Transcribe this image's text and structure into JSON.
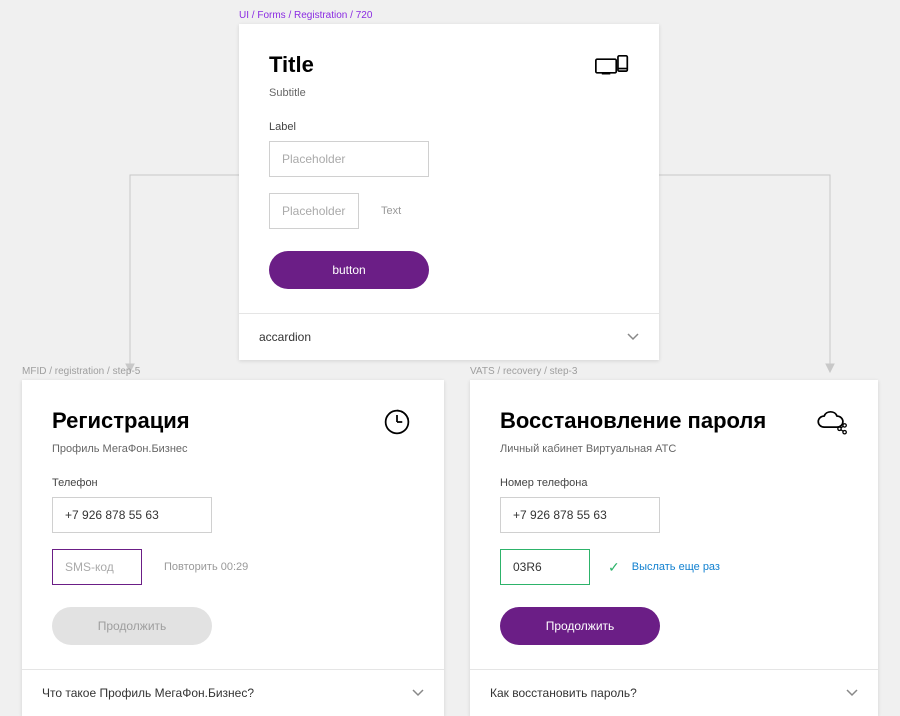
{
  "top": {
    "breadcrumb": "UI / Forms / Registration / 720",
    "title": "Title",
    "subtitle": "Subtitle",
    "label": "Label",
    "placeholder1": "Placeholder",
    "placeholder2": "Placeholder",
    "side_text": "Text",
    "button": "button",
    "accordion": "accardion"
  },
  "left": {
    "breadcrumb": "MFID / registration / step-5",
    "title": "Регистрация",
    "subtitle": "Профиль МегаФон.Бизнес",
    "label": "Телефон",
    "phone_value": "+7 926 878 55 63",
    "sms_placeholder": "SMS-код",
    "repeat_text": "Повторить 00:29",
    "button": "Продолжить",
    "accordion": "Что такое Профиль МегаФон.Бизнес?"
  },
  "right": {
    "breadcrumb": "VATS / recovery / step-3",
    "title": "Восстановление пароля",
    "subtitle": "Личный кабинет Виртуальная АТС",
    "label": "Номер телефона",
    "phone_value": "+7 926 878 55 63",
    "code_value": "03R6",
    "resend_text": "Выслать еще раз",
    "button": "Продолжить",
    "accordion": "Как восстановить пароль?"
  }
}
